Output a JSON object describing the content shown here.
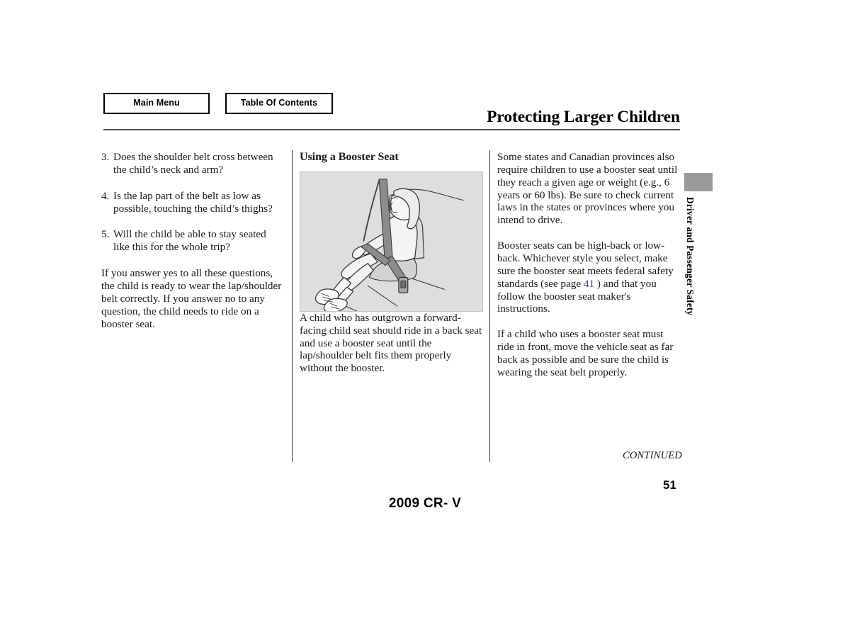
{
  "nav": {
    "main_menu_label": "Main Menu",
    "toc_label": "Table Of Contents"
  },
  "header": {
    "title": "Protecting Larger Children"
  },
  "left_column": {
    "questions": [
      {
        "number": "3.",
        "text": "Does the shoulder belt cross between the child’s neck and arm?"
      },
      {
        "number": "4.",
        "text": "Is the lap part of the belt as low as possible, touching the child’s thighs?"
      },
      {
        "number": "5.",
        "text": "Will the child be able to stay seated like this for the whole trip?"
      }
    ],
    "paragraph": "If you answer yes to all these questions, the child is ready to wear the lap/shoulder belt correctly. If you answer no to any question, the child needs to ride on a booster seat."
  },
  "middle_column": {
    "heading": "Using a Booster Seat",
    "figure_alt": "Illustration of a child seated on a booster seat wearing a lap/shoulder belt",
    "caption": "A child who has outgrown a forward-facing child seat should ride in a back seat and use a booster seat until the lap/shoulder belt fits them properly without the booster."
  },
  "right_column": {
    "paragraph_1": "Some states and Canadian provinces also require children to use a booster seat until they reach a given age or weight (e.g., 6 years or 60 lbs). Be sure to check current laws in the states or provinces where you intend to drive.",
    "paragraph_2_before_link": "Booster seats can be high-back or low-back. Whichever style you select, make sure the booster seat meets federal safety standards (see page",
    "page_link": "41",
    "paragraph_2_after_link": ") and that you follow the booster seat maker's instructions.",
    "paragraph_3": "If a child who uses a booster seat must ride in front, move the vehicle seat as far back as possible and be sure the child is wearing the seat belt properly."
  },
  "side_tab": {
    "label": "Driver and Passenger Safety"
  },
  "footer": {
    "continued": "CONTINUED",
    "page_number": "51",
    "model": "2009 CR- V"
  },
  "colors": {
    "link": "#3333aa",
    "tab_marker": "#9a9a9a",
    "figure_background": "#dedede",
    "rule": "#4a4a4a"
  }
}
